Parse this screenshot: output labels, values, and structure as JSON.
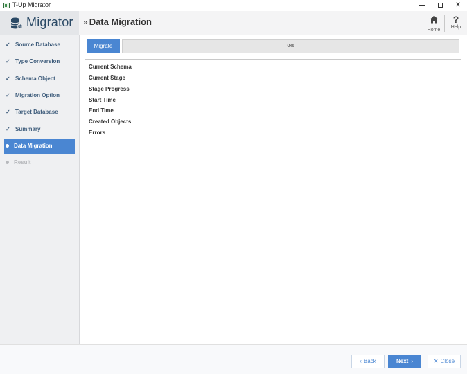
{
  "window": {
    "title": "T-Up Migrator"
  },
  "header": {
    "brand": "Migrator",
    "page_title": "Data Migration",
    "home_label": "Home",
    "help_label": "Help"
  },
  "sidebar": {
    "items": [
      {
        "label": "Source Database",
        "state": "done"
      },
      {
        "label": "Type Conversion",
        "state": "done"
      },
      {
        "label": "Schema Object",
        "state": "done"
      },
      {
        "label": "Migration Option",
        "state": "done"
      },
      {
        "label": "Target Database",
        "state": "done"
      },
      {
        "label": "Summary",
        "state": "done"
      },
      {
        "label": "Data Migration",
        "state": "active"
      },
      {
        "label": "Result",
        "state": "disabled"
      }
    ]
  },
  "main": {
    "migrate_label": "Migrate",
    "progress_percent": 0,
    "progress_text": "0%",
    "info_rows": [
      {
        "label": "Current Schema"
      },
      {
        "label": "Current Stage"
      },
      {
        "label": "Stage Progress"
      },
      {
        "label": "Start Time"
      },
      {
        "label": "End Time"
      },
      {
        "label": "Created Objects"
      },
      {
        "label": "Errors"
      }
    ]
  },
  "footer": {
    "back_label": "Back",
    "next_label": "Next",
    "close_label": "Close"
  },
  "colors": {
    "accent": "#4a86d2",
    "brand_text": "#2b4a66",
    "sidebar_text": "#3f5d7c",
    "disabled_text": "#b7b9bd"
  }
}
